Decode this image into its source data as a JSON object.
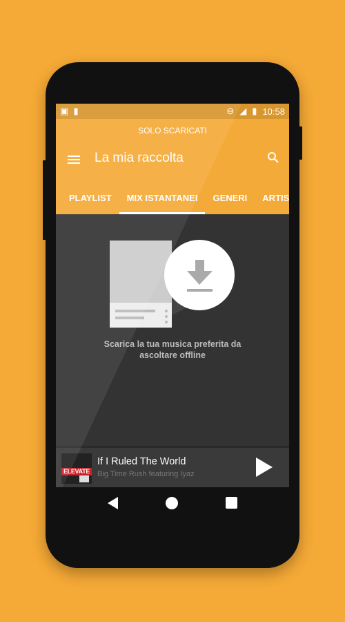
{
  "status_bar": {
    "time": "10:58",
    "icons": [
      "image-icon",
      "cup-icon",
      "do-not-disturb-icon",
      "signal-icon",
      "battery-charging-icon"
    ]
  },
  "header": {
    "filter_label": "SOLO SCARICATI",
    "title": "La mia raccolta"
  },
  "tabs": [
    {
      "label": "PLAYLIST"
    },
    {
      "label": "MIX ISTANTANEI",
      "active": true
    },
    {
      "label": "GENERI"
    },
    {
      "label": "ARTISTI"
    }
  ],
  "empty_state": {
    "line1": "Scarica la tua musica preferita da",
    "line2": "ascoltare offline"
  },
  "now_playing": {
    "title": "If I Ruled The World",
    "artist": "Big Time Rush featuring Iyaz",
    "album_art_text": "ELEVATE"
  },
  "colors": {
    "accent": "#f4aa38",
    "background": "#f5a936",
    "content": "#333333"
  }
}
